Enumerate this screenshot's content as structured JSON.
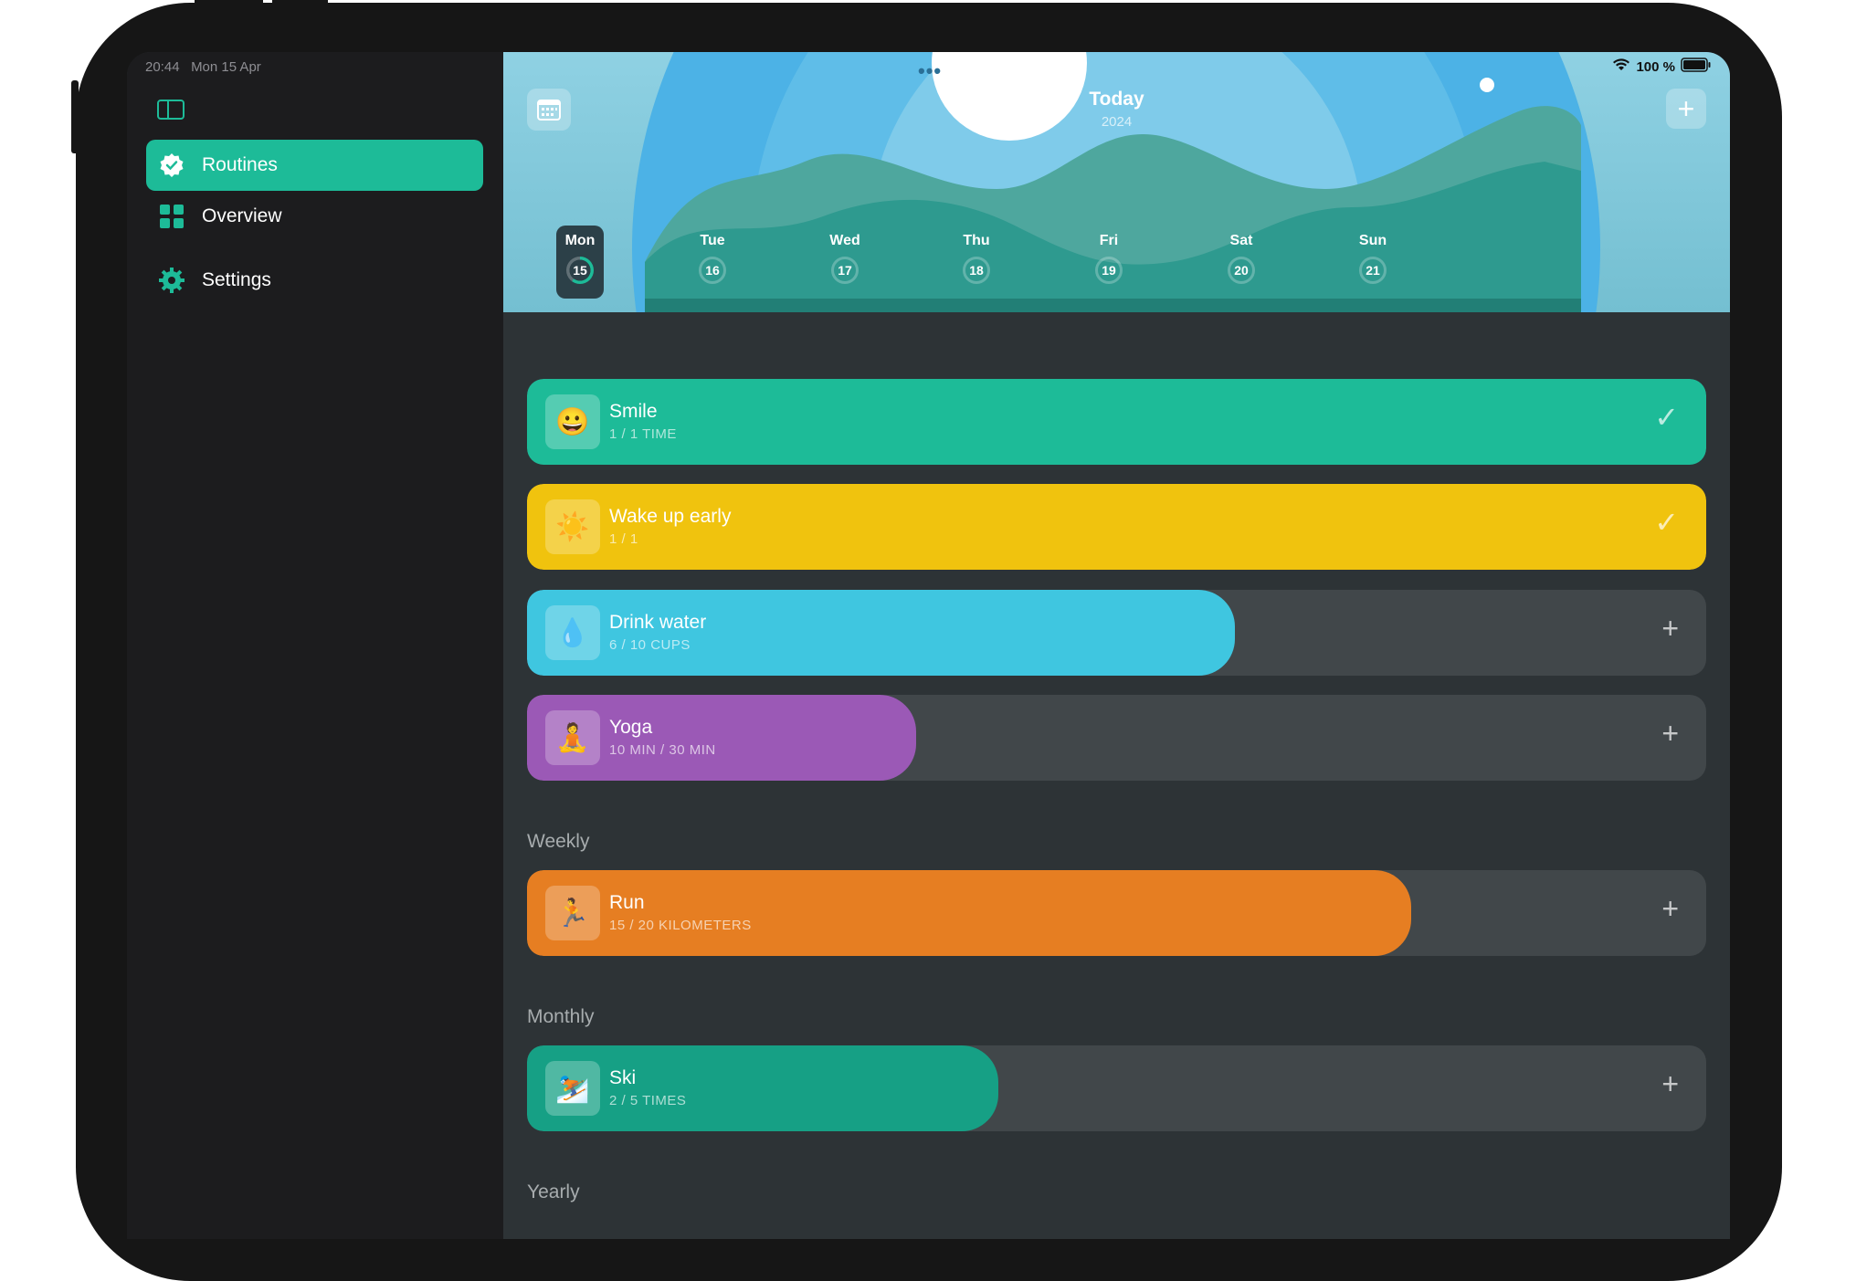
{
  "status": {
    "time": "20:44",
    "date": "Mon 15 Apr",
    "battery": "100 %"
  },
  "sidebar": {
    "items": [
      {
        "label": "Routines",
        "icon": "check-badge-icon",
        "active": true
      },
      {
        "label": "Overview",
        "icon": "grid-icon",
        "active": false
      },
      {
        "label": "Settings",
        "icon": "gear-icon",
        "active": false
      }
    ]
  },
  "header": {
    "title": "Today",
    "subtitle": "2024"
  },
  "days": [
    {
      "name": "Mon",
      "num": "15",
      "selected": true,
      "progress": 0.6
    },
    {
      "name": "Tue",
      "num": "16"
    },
    {
      "name": "Wed",
      "num": "17"
    },
    {
      "name": "Thu",
      "num": "18"
    },
    {
      "name": "Fri",
      "num": "19"
    },
    {
      "name": "Sat",
      "num": "20"
    },
    {
      "name": "Sun",
      "num": "21"
    }
  ],
  "routines": [
    {
      "name": "Smile",
      "detail": "1 / 1 TIME",
      "emoji": "😀",
      "color": "#1dbb98",
      "progress": 1.0,
      "action": "✓"
    },
    {
      "name": "Wake up early",
      "detail": "1 / 1",
      "emoji": "☀️",
      "color": "#f0c30e",
      "progress": 1.0,
      "action": "✓"
    },
    {
      "name": "Drink water",
      "detail": "6 / 10 CUPS",
      "emoji": "💧",
      "color": "#3fc6e0",
      "progress": 0.6,
      "action": "+"
    },
    {
      "name": "Yoga",
      "detail": "10 MIN / 30 MIN",
      "emoji": "🧘",
      "color": "#9b59b6",
      "progress": 0.33,
      "action": "+"
    }
  ],
  "sections": {
    "weekly": {
      "label": "Weekly",
      "routines": [
        {
          "name": "Run",
          "detail": "15 / 20 KILOMETERS",
          "emoji": "🏃",
          "color": "#e67e22",
          "progress": 0.75,
          "action": "+"
        }
      ]
    },
    "monthly": {
      "label": "Monthly",
      "routines": [
        {
          "name": "Ski",
          "detail": "2 / 5 TIMES",
          "emoji": "⛷️",
          "color": "#16a085",
          "progress": 0.4,
          "action": "+"
        }
      ]
    },
    "yearly": {
      "label": "Yearly"
    }
  }
}
